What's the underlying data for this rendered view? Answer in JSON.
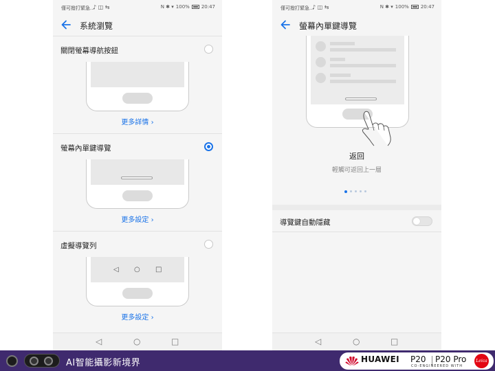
{
  "left_screen": {
    "status": {
      "carrier": "僅可撥打緊急...",
      "icons": "♪ ◫ ⇆",
      "right_icons": "N ✱ ▾",
      "battery": "100%",
      "time": "20:47"
    },
    "title": "系統瀏覽",
    "options": [
      {
        "label": "關閉螢幕導航按鈕",
        "selected": false,
        "link": "更多詳情 ›"
      },
      {
        "label": "螢幕內單鍵導覽",
        "selected": true,
        "link": "更多設定 ›"
      },
      {
        "label": "虛擬導覽列",
        "selected": false,
        "link": "更多設定 ›",
        "nav_glyphs": [
          "◁",
          "○",
          "□"
        ]
      }
    ],
    "navbar": [
      "◁",
      "○",
      "□"
    ]
  },
  "right_screen": {
    "status": {
      "carrier": "僅可撥打緊急...",
      "icons": "♪ ◫ ⇆",
      "right_icons": "N ✱ ▾",
      "battery": "100%",
      "time": "20:47"
    },
    "title": "螢幕內單鍵導覽",
    "gesture_title": "返回",
    "gesture_subtitle": "輕觸可返回上一層",
    "page_indicator": {
      "count": 5,
      "active": 0
    },
    "setting_label": "導覽鍵自動隱藏",
    "setting_on": false,
    "navbar": [
      "◁",
      "○",
      "□"
    ]
  },
  "footer": {
    "slogan": "AI智能攝影新境界",
    "brand": "HUAWEI",
    "model_1": "P20",
    "model_2": "P20 Pro",
    "tagline": "CO-ENGINEERED WITH",
    "partner": "Leica",
    "colors": {
      "band": "#3f2a6e",
      "accent": "#1a73e8",
      "partner": "#e30613",
      "brand_flower": "#cf0a2c"
    }
  }
}
